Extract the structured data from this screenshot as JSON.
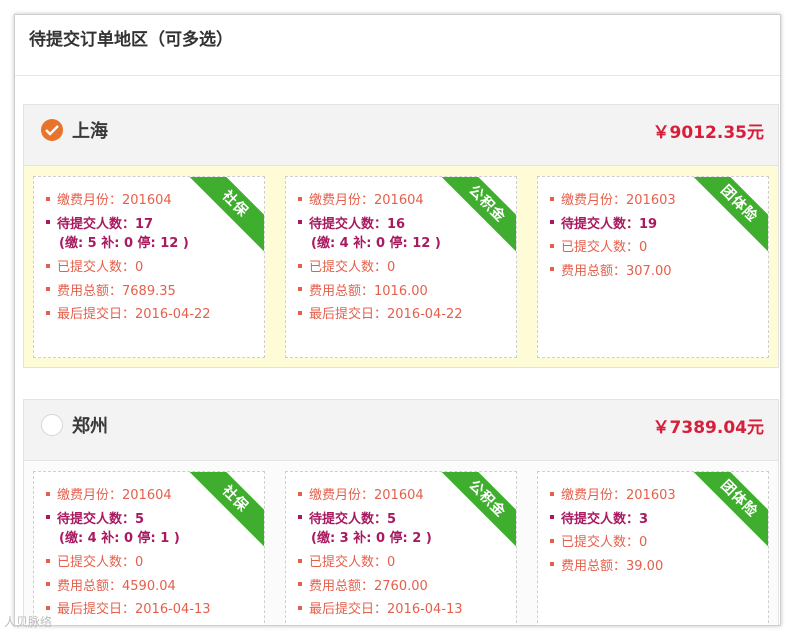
{
  "panel": {
    "title": "待提交订单地区（可多选）"
  },
  "regions": [
    {
      "name": "上海",
      "total": "￥9012.35元",
      "selected": true,
      "cards": [
        {
          "ribbon": "社保",
          "fee_month": "缴费月份：201604",
          "pending_count": "待提交人数：17",
          "breakdown": "(缴: 5  补: 0 停: 12 )",
          "submitted_count": "已提交人数：0",
          "fee_total": "费用总额：7689.35",
          "last_date": "最后提交日：2016-04-22"
        },
        {
          "ribbon": "公积金",
          "fee_month": "缴费月份：201604",
          "pending_count": "待提交人数：16",
          "breakdown": "(缴: 4  补: 0 停: 12 )",
          "submitted_count": "已提交人数：0",
          "fee_total": "费用总额：1016.00",
          "last_date": "最后提交日：2016-04-22"
        },
        {
          "ribbon": "团体险",
          "fee_month": "缴费月份：201603",
          "pending_count": "待提交人数：19",
          "submitted_count": "已提交人数：0",
          "fee_total": "费用总额：307.00"
        }
      ]
    },
    {
      "name": "郑州",
      "total": "￥7389.04元",
      "selected": false,
      "cards": [
        {
          "ribbon": "社保",
          "fee_month": "缴费月份：201604",
          "pending_count": "待提交人数：5",
          "breakdown": "(缴: 4  补: 0 停: 1 )",
          "submitted_count": "已提交人数：0",
          "fee_total": "费用总额：4590.04",
          "last_date": "最后提交日：2016-04-13"
        },
        {
          "ribbon": "公积金",
          "fee_month": "缴费月份：201604",
          "pending_count": "待提交人数：5",
          "breakdown": "(缴: 3  补: 0 停: 2 )",
          "submitted_count": "已提交人数：0",
          "fee_total": "费用总额：2760.00",
          "last_date": "最后提交日：2016-04-13"
        },
        {
          "ribbon": "团体险",
          "fee_month": "缴费月份：201603",
          "pending_count": "待提交人数：3",
          "submitted_count": "已提交人数：0",
          "fee_total": "费用总额：39.00"
        }
      ]
    }
  ],
  "watermark": "人贝脉络",
  "colors": {
    "check_on": "#e8742b",
    "ribbon": "#3fad2d",
    "total": "#d71e3a",
    "line": "#e4604c",
    "emphasis": "#a8195f",
    "selected_bg": "#fefcd6"
  },
  "icons": {
    "check": "check-circle-icon",
    "unchecked": "unchecked-circle-icon"
  }
}
